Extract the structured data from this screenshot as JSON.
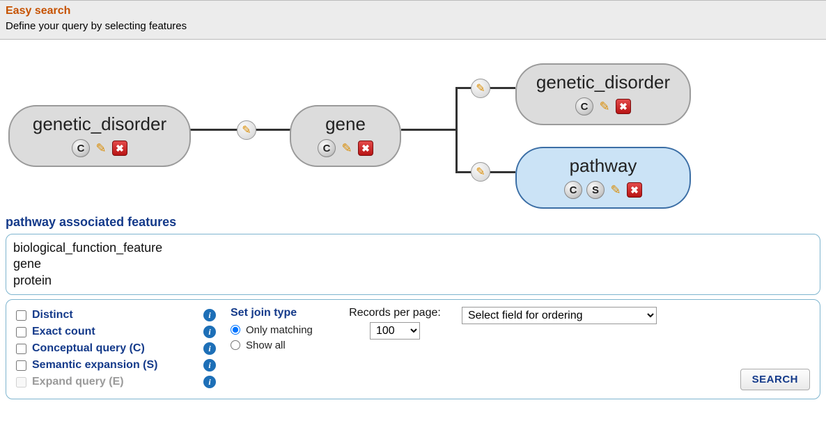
{
  "header": {
    "title": "Easy search",
    "subtitle": "Define your query by selecting features"
  },
  "graph": {
    "nodes": {
      "n1": {
        "label": "genetic_disorder",
        "badges": [
          "C"
        ]
      },
      "n2": {
        "label": "gene",
        "badges": [
          "C"
        ]
      },
      "n3": {
        "label": "genetic_disorder",
        "badges": [
          "C"
        ]
      },
      "n4": {
        "label": "pathway",
        "badges": [
          "C",
          "S"
        ]
      }
    }
  },
  "features": {
    "section_title": "pathway associated features",
    "items": [
      "biological_function_feature",
      "gene",
      "protein"
    ]
  },
  "options": {
    "checkboxes": {
      "distinct": "Distinct",
      "exact_count": "Exact count",
      "conceptual": "Conceptual query (C)",
      "semantic": "Semantic expansion (S)",
      "expand": "Expand query (E)"
    },
    "join": {
      "title": "Set join type",
      "only_matching": "Only matching",
      "show_all": "Show all",
      "selected": "only_matching"
    },
    "records_per_page": {
      "label": "Records per page:",
      "value": "100"
    },
    "ordering": {
      "placeholder": "Select field for ordering"
    },
    "search_button": "SEARCH",
    "info_glyph": "i"
  }
}
